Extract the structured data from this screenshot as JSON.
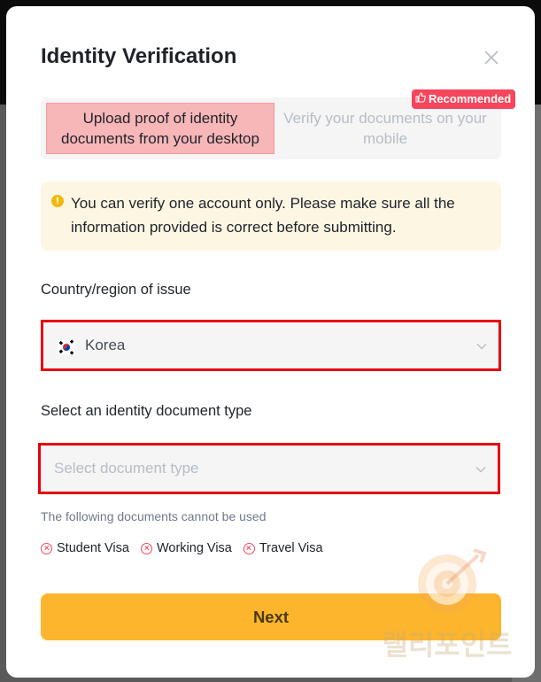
{
  "modal": {
    "title": "Identity Verification"
  },
  "tabs": {
    "desktop_label": "Upload proof of identity documents from your desktop",
    "mobile_label": "Verify your documents on your mobile",
    "badge_label": "Recommended"
  },
  "notice": {
    "text": "You can verify one account only. Please make sure all the information provided is correct before submitting."
  },
  "country": {
    "label": "Country/region of issue",
    "value": "Korea"
  },
  "document": {
    "label": "Select an identity document type",
    "placeholder": "Select document type"
  },
  "restrictions": {
    "note": "The following documents cannot be used",
    "items": [
      "Student Visa",
      "Working Visa",
      "Travel Visa"
    ]
  },
  "actions": {
    "next_label": "Next"
  },
  "watermark": {
    "text": "랠리포인트"
  },
  "colors": {
    "accent": "#fcb52d",
    "highlight_border": "#e8000d",
    "badge": "#f6465d",
    "notice_bg": "#fdf6e3"
  }
}
